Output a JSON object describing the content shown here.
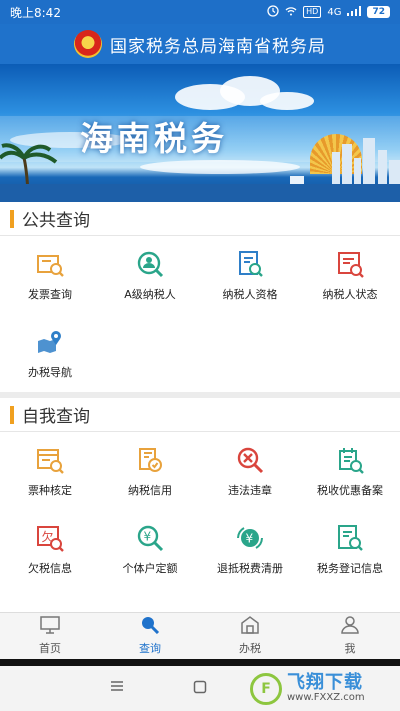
{
  "status_bar": {
    "time": "晚上8:42",
    "network": "4G",
    "battery": "72",
    "signal_box": "HD"
  },
  "header": {
    "title": "国家税务总局海南省税务局"
  },
  "banner": {
    "title": "海南税务"
  },
  "public_query": {
    "title": "公共查询",
    "items": [
      {
        "label": "发票查询",
        "icon": "invoice-search-icon"
      },
      {
        "label": "A级纳税人",
        "icon": "a-grade-taxpayer-icon"
      },
      {
        "label": "纳税人资格",
        "icon": "taxpayer-qualification-icon"
      },
      {
        "label": "纳税人状态",
        "icon": "taxpayer-status-icon"
      },
      {
        "label": "办税导航",
        "icon": "map-navigation-icon"
      }
    ]
  },
  "self_query": {
    "title": "自我查询",
    "items": [
      {
        "label": "票种核定",
        "icon": "ticket-type-icon"
      },
      {
        "label": "纳税信用",
        "icon": "tax-credit-icon"
      },
      {
        "label": "违法违章",
        "icon": "violation-icon"
      },
      {
        "label": "税收优惠备案",
        "icon": "tax-preference-icon"
      },
      {
        "label": "欠税信息",
        "icon": "tax-arrears-icon"
      },
      {
        "label": "个体户定额",
        "icon": "individual-quota-icon"
      },
      {
        "label": "退抵税费清册",
        "icon": "refund-list-icon"
      },
      {
        "label": "税务登记信息",
        "icon": "tax-registration-icon"
      }
    ]
  },
  "tabbar": {
    "items": [
      {
        "label": "首页",
        "icon": "home-monitor-icon"
      },
      {
        "label": "查询",
        "icon": "search-icon"
      },
      {
        "label": "办税",
        "icon": "office-icon"
      },
      {
        "label": "我",
        "icon": "user-icon"
      }
    ],
    "active": "查询"
  },
  "watermark": {
    "name": "飞翔下载",
    "url": "www.FXXZ.com"
  },
  "colors": {
    "brand_blue": "#1f72cb",
    "section_accent": "#f0a020",
    "icon_orange": "#e8a23c",
    "icon_green": "#2aa58a",
    "icon_blue": "#2f7fc8",
    "icon_red": "#d9453d"
  }
}
